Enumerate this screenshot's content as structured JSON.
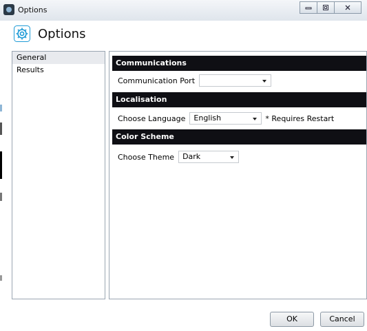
{
  "window": {
    "title": "Options",
    "caption_buttons": [
      "minimize",
      "maximize",
      "close"
    ]
  },
  "header": {
    "title": "Options",
    "icon": "gear-icon",
    "accent_color": "#1c9ad6"
  },
  "nav": {
    "items": [
      {
        "label": "General",
        "selected": true
      },
      {
        "label": "Results",
        "selected": false
      }
    ]
  },
  "sections": {
    "communications": {
      "title": "Communications",
      "port_label": "Communication Port",
      "port_value": ""
    },
    "localisation": {
      "title": "Localisation",
      "language_label": "Choose Language",
      "language_value": "English",
      "restart_note": "* Requires Restart"
    },
    "color_scheme": {
      "title": "Color Scheme",
      "theme_label": "Choose Theme",
      "theme_value": "Dark"
    }
  },
  "footer": {
    "ok_label": "OK",
    "cancel_label": "Cancel"
  },
  "colors": {
    "section_header_bg": "#0f0f14",
    "section_header_text": "#ffffff",
    "nav_selected_bg": "#e8eaee"
  }
}
